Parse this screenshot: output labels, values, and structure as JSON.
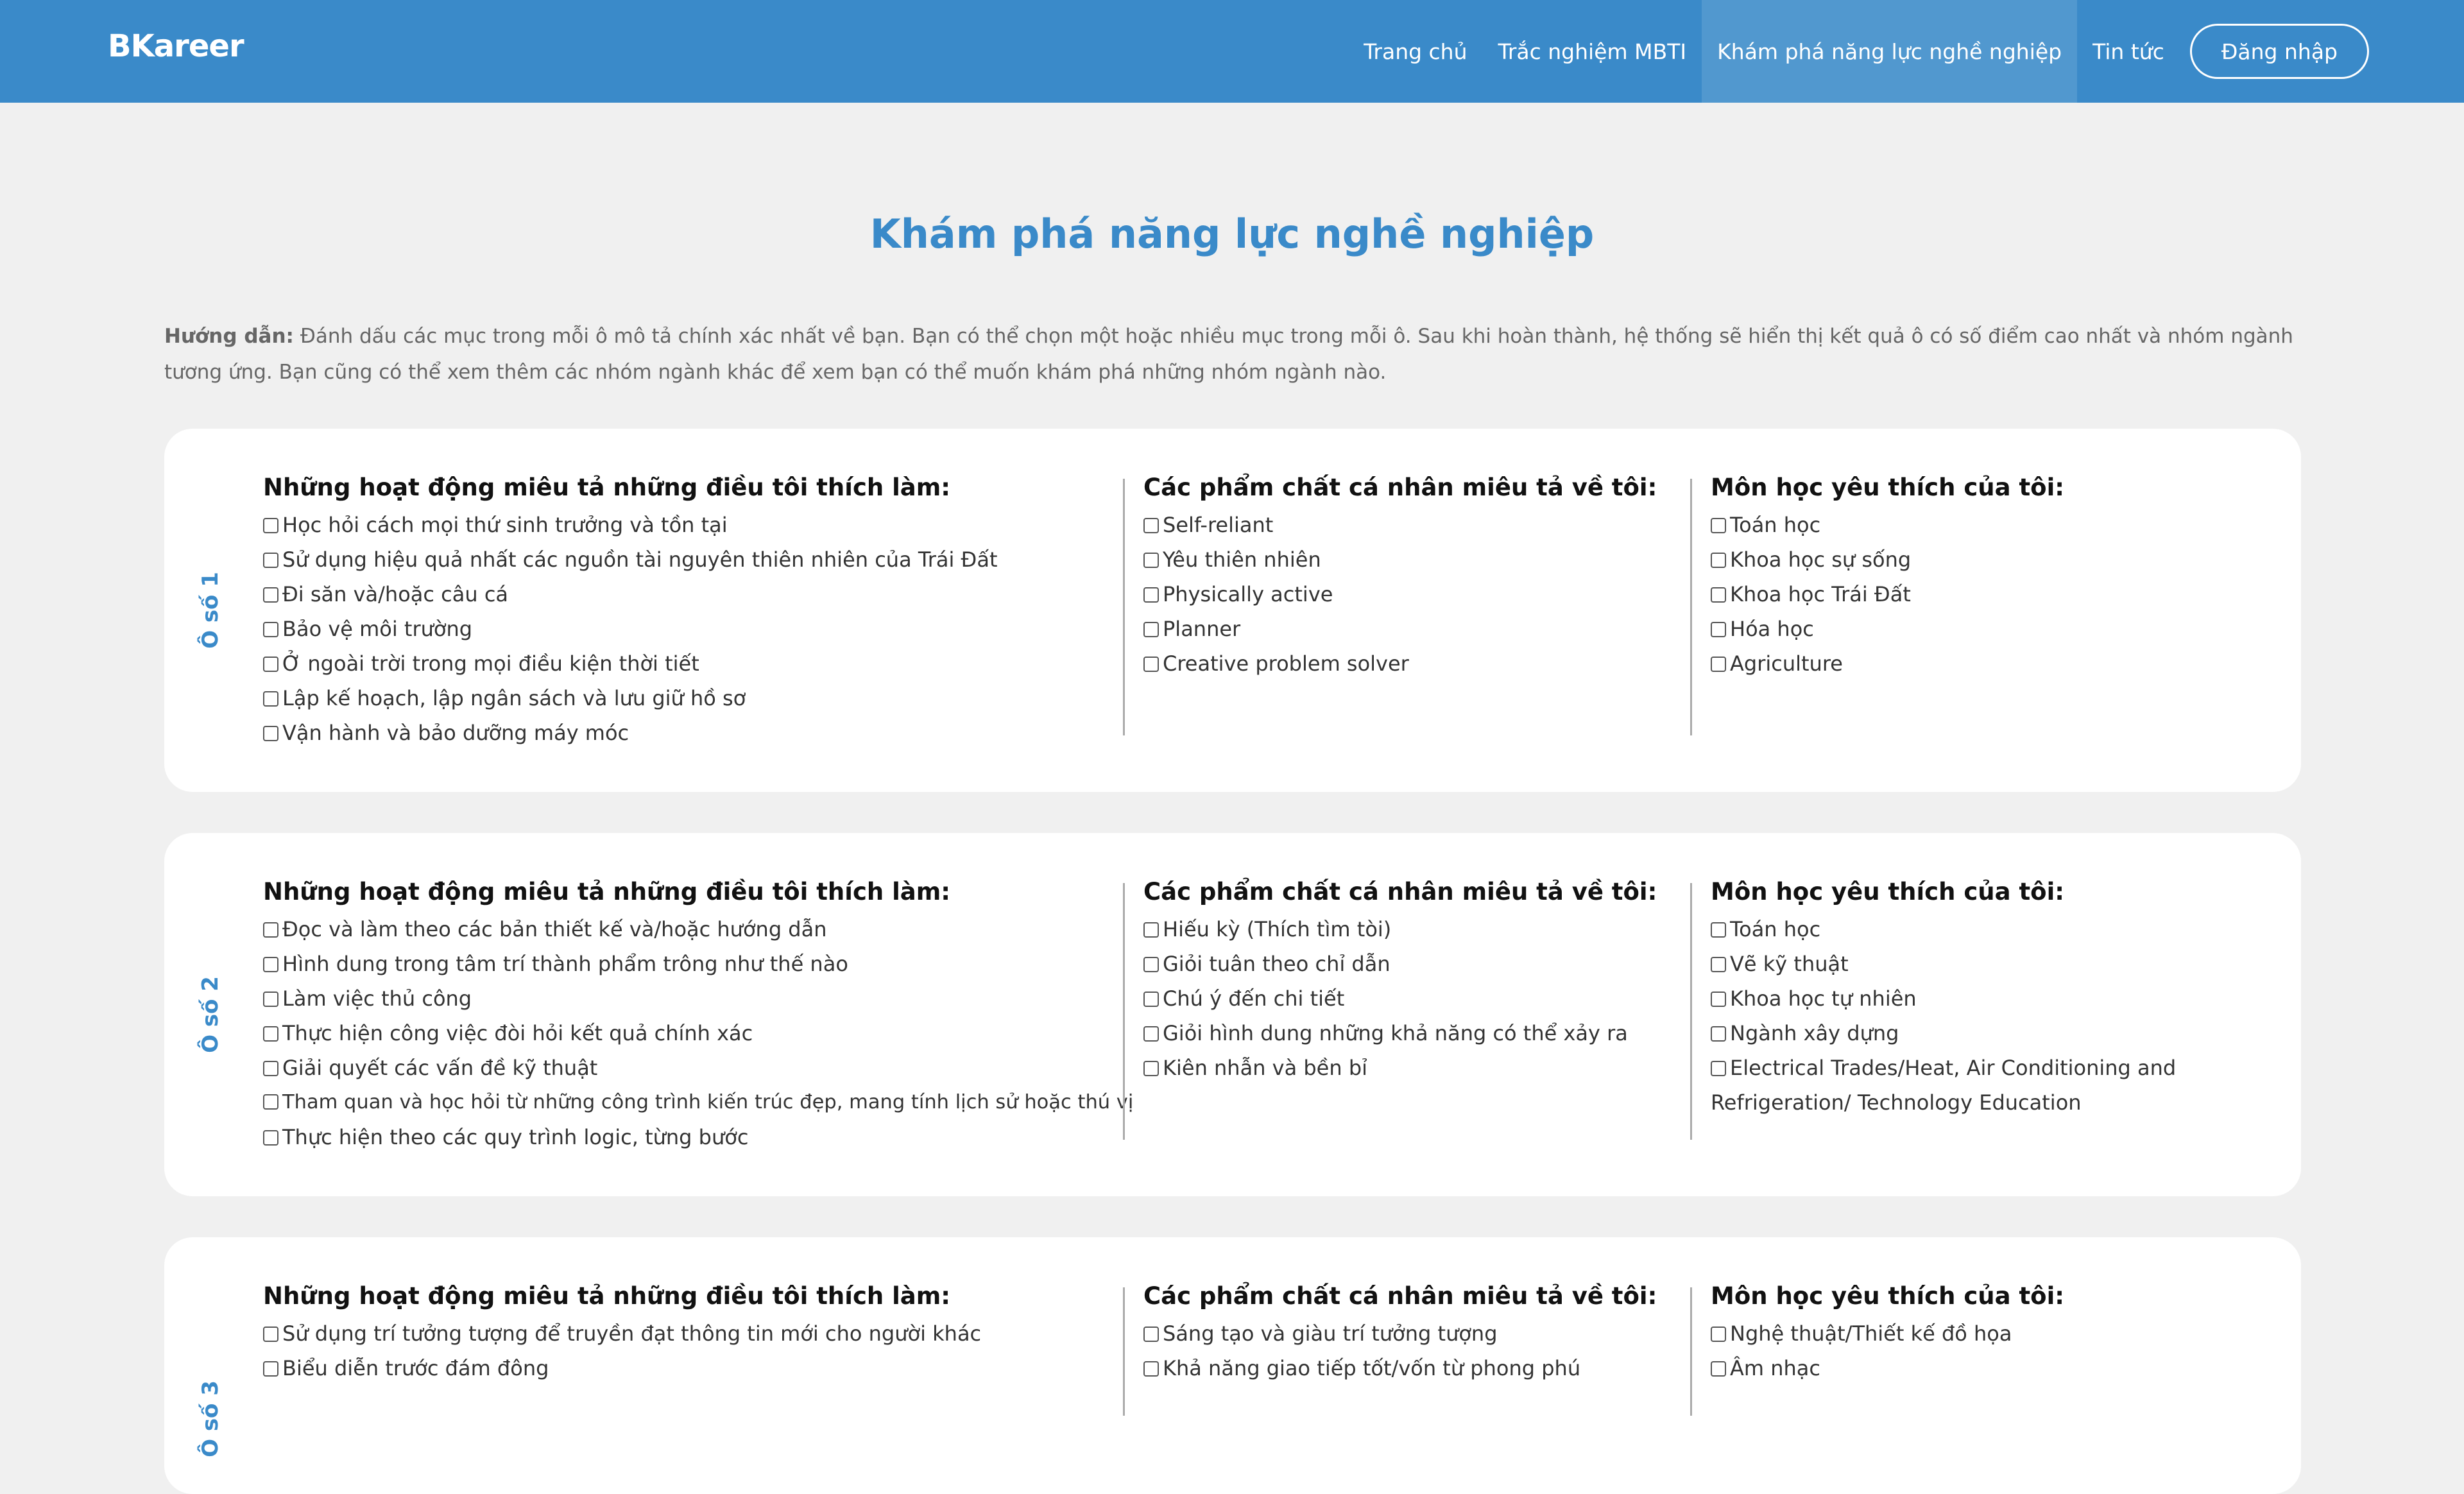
{
  "nav": {
    "brand": "BKareer",
    "links": [
      "Trang chủ",
      "Trắc nghiệm MBTI",
      "Khám phá năng lực nghề nghiệp",
      "Tin tức"
    ],
    "login": "Đăng nhập"
  },
  "page_title": "Khám phá năng lực nghề nghiệp",
  "instructions": {
    "lead": "Hướng dẫn:",
    "text": "Đánh dấu các mục trong mỗi ô mô tả chính xác nhất về bạn. Bạn có thể chọn một hoặc nhiều mục trong mỗi ô. Sau khi hoàn thành, hệ thống sẽ hiển thị kết quả ô có số điểm cao nhất và nhóm ngành tương ứng. Bạn cũng có thể xem thêm các nhóm ngành khác để xem bạn có thể muốn khám phá những nhóm ngành nào."
  },
  "column_titles": {
    "activities": "Những hoạt động miêu tả những điều tôi thích làm:",
    "traits": "Các phẩm chất cá nhân miêu tả về tôi:",
    "subjects": "Môn học yêu thích của tôi:"
  },
  "boxes": [
    {
      "label": "Ô số 1",
      "activities": [
        "Học hỏi cách mọi thứ sinh trưởng và tồn tại",
        "Sử dụng hiệu quả nhất các nguồn tài nguyên thiên nhiên của Trái Đất",
        "Đi săn và/hoặc câu cá",
        "Bảo vệ môi trường",
        "Ở ngoài trời trong mọi điều kiện thời tiết",
        "Lập kế hoạch, lập ngân sách và lưu giữ hồ sơ",
        "Vận hành và bảo dưỡng máy móc"
      ],
      "traits": [
        "Self-reliant",
        "Yêu thiên nhiên",
        "Physically active",
        "Planner",
        "Creative problem solver"
      ],
      "subjects": [
        "Toán học",
        "Khoa học sự sống",
        "Khoa học Trái Đất",
        "Hóa học",
        "Agriculture"
      ]
    },
    {
      "label": "Ô số 2",
      "activities": [
        "Đọc và làm theo các bản thiết kế và/hoặc hướng dẫn",
        "Hình dung trong tâm trí thành phẩm trông như thế nào",
        "Làm việc thủ công",
        "Thực hiện công việc đòi hỏi kết quả chính xác",
        "Giải quyết các vấn đề kỹ thuật",
        "Tham quan và học hỏi từ những công trình kiến trúc đẹp, mang tính lịch sử hoặc thú vị",
        "Thực hiện theo các quy trình logic, từng bước"
      ],
      "traits": [
        "Hiếu kỳ (Thích tìm tòi)",
        "Giỏi tuân theo chỉ dẫn",
        "Chú ý đến chi tiết",
        "Giỏi hình dung những khả năng có thể xảy ra",
        "Kiên nhẫn và bền bỉ"
      ],
      "subjects": [
        "Toán học",
        "Vẽ kỹ thuật",
        "Khoa học tự nhiên",
        "Ngành xây dựng",
        "Electrical Trades/Heat, Air Conditioning and Refrigeration/ Technology Education"
      ]
    },
    {
      "label": "Ô số 3",
      "activities": [
        "Sử dụng trí tưởng tượng để truyền đạt thông tin mới cho người khác",
        "Biểu diễn trước đám đông"
      ],
      "traits": [
        "Sáng tạo và giàu trí tưởng tượng",
        "Khả năng giao tiếp tốt/vốn từ phong phú"
      ],
      "subjects": [
        "Nghệ thuật/Thiết kế đồ họa",
        "Âm nhạc"
      ]
    }
  ]
}
